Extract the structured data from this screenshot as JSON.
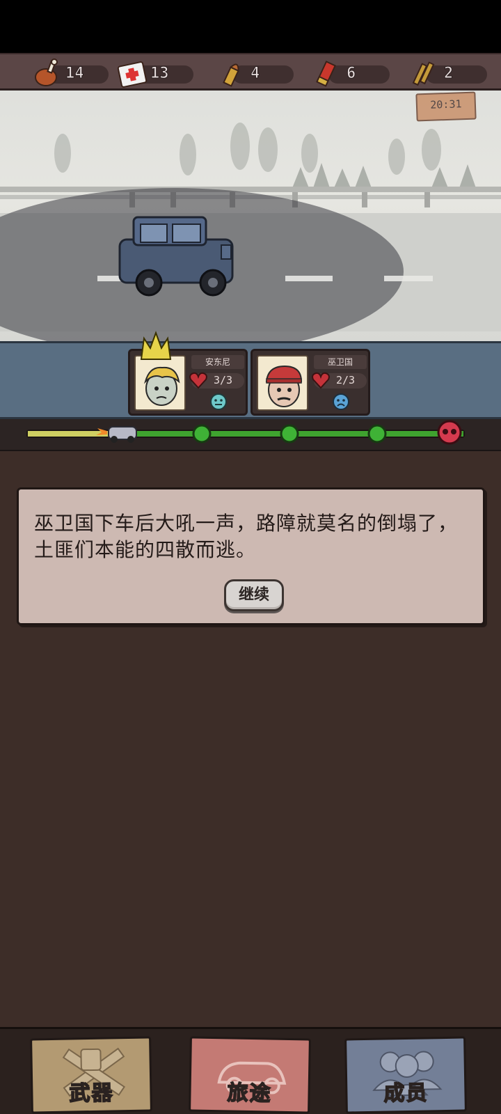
{
  "resources": [
    {
      "icon": "meat-icon",
      "value": "14"
    },
    {
      "icon": "medkit-icon",
      "value": "13"
    },
    {
      "icon": "pistol-bullet-icon",
      "value": "4"
    },
    {
      "icon": "shotgun-shell-icon",
      "value": "6"
    },
    {
      "icon": "rifle-ammo-icon",
      "value": "2"
    }
  ],
  "clock": "20:31",
  "party": [
    {
      "name": "安东尼",
      "hp": "3/3",
      "mood": "neutral",
      "leader": true,
      "portrait_icon": "blond-survivor-portrait"
    },
    {
      "name": "巫卫国",
      "hp": "2/3",
      "mood": "sad",
      "leader": false,
      "portrait_icon": "red-cap-survivor-portrait"
    }
  ],
  "journey": {
    "progress": 0.2,
    "checkpoints": 3,
    "end_icon": "skull-icon"
  },
  "dialog": {
    "message": "巫卫国下车后大吼一声，路障就莫名的倒塌了，土匪们本能的四散而逃。",
    "continue_label": "继续"
  },
  "nav": [
    {
      "label": "武器",
      "icon": "weapons-icon",
      "color": "#b39a72"
    },
    {
      "label": "旅途",
      "icon": "car-icon",
      "color": "#c47a74"
    },
    {
      "label": "成员",
      "icon": "members-icon",
      "color": "#737f97"
    }
  ]
}
